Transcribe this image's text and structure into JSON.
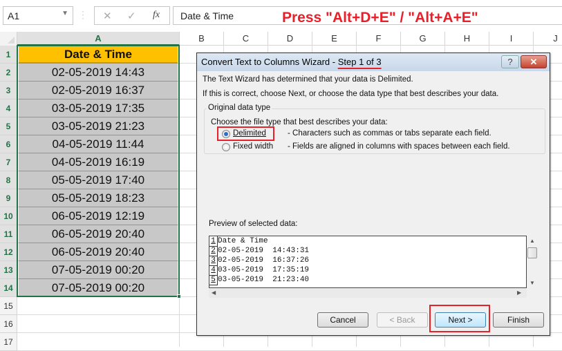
{
  "formula_bar": {
    "name_box": "A1",
    "cancel_icon": "✕",
    "enter_icon": "✓",
    "fx_label": "fx",
    "formula": "Date & Time"
  },
  "annotation": "Press \"Alt+D+E\" / \"Alt+A+E\"",
  "columns": [
    "A",
    "B",
    "C",
    "D",
    "E",
    "F",
    "G",
    "H",
    "I",
    "J"
  ],
  "rows": [
    "1",
    "2",
    "3",
    "4",
    "5",
    "6",
    "7",
    "8",
    "9",
    "10",
    "11",
    "12",
    "13",
    "14",
    "15",
    "16",
    "17"
  ],
  "sheet": {
    "header": "Date & Time",
    "values": [
      "02-05-2019 14:43",
      "02-05-2019 16:37",
      "03-05-2019 17:35",
      "03-05-2019 21:23",
      "04-05-2019 11:44",
      "04-05-2019 16:19",
      "05-05-2019 17:40",
      "05-05-2019 18:23",
      "06-05-2019 12:19",
      "06-05-2019 20:40",
      "06-05-2019 20:40",
      "07-05-2019 00:20",
      "07-05-2019 00:20"
    ]
  },
  "dialog": {
    "title": "Convert Text to Columns Wizard - ",
    "step": "Step 1 of 3",
    "help": "?",
    "close": "✕",
    "line1": "The Text Wizard has determined that your data is Delimited.",
    "line2": "If this is correct, choose Next, or choose the data type that best describes your data.",
    "group_label": "Original data type",
    "group_prompt": "Choose the file type that best describes your data:",
    "options": [
      {
        "label": "Delimited",
        "desc": "- Characters such as commas or tabs separate each field.",
        "selected": true
      },
      {
        "label": "Fixed width",
        "desc": "- Fields are aligned in columns with spaces between each field.",
        "selected": false
      }
    ],
    "preview_label": "Preview of selected data:",
    "preview_lines": [
      {
        "n": "1",
        "text": "Date & Time"
      },
      {
        "n": "2",
        "text": "02-05-2019  14:43:31"
      },
      {
        "n": "3",
        "text": "02-05-2019  16:37:26"
      },
      {
        "n": "4",
        "text": "03-05-2019  17:35:19"
      },
      {
        "n": "5",
        "text": "03-05-2019  21:23:40"
      }
    ],
    "buttons": {
      "cancel": "Cancel",
      "back": "< Back",
      "next": "Next >",
      "finish": "Finish"
    }
  },
  "colors": {
    "header_fill": "#ffc000",
    "cell_fill": "#c8c8c8",
    "selection": "#217346",
    "highlight": "#e8202a"
  }
}
